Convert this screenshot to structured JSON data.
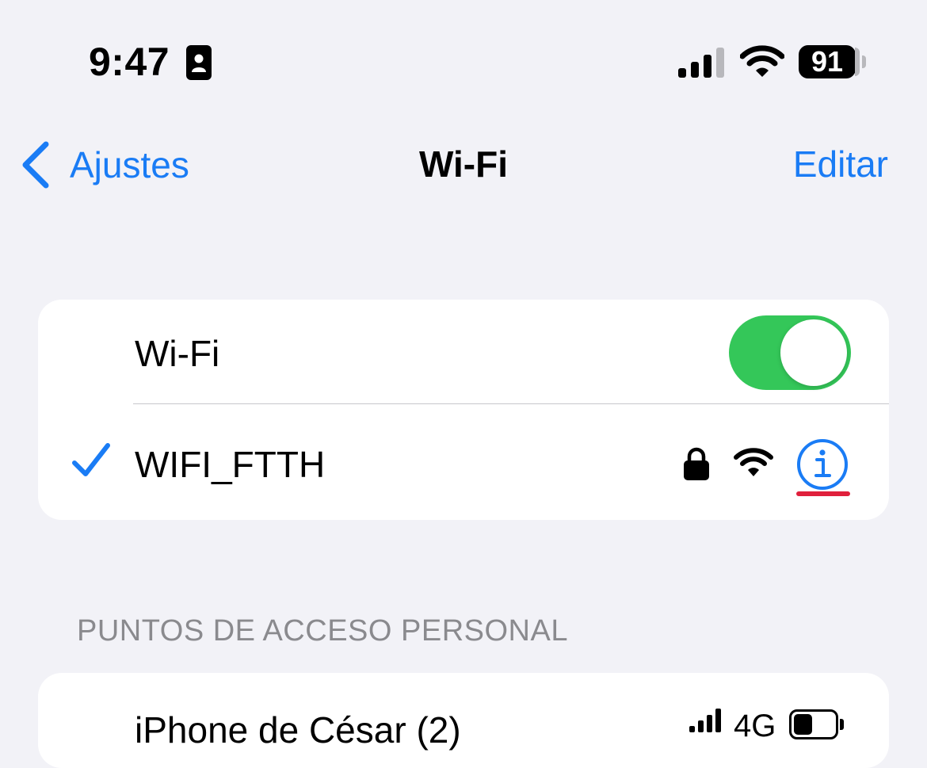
{
  "status_bar": {
    "time": "9:47",
    "battery_level": "91",
    "icons": [
      "contact-card-icon",
      "cellular-signal-icon",
      "wifi-icon",
      "battery-icon"
    ]
  },
  "nav": {
    "back_label": "Ajustes",
    "title": "Wi-Fi",
    "edit_label": "Editar"
  },
  "wifi_section": {
    "wifi_toggle_label": "Wi-Fi",
    "wifi_enabled": true,
    "connected_network": {
      "name": "WIFI_FTTH",
      "selected": true,
      "icons": [
        "checkmark-icon",
        "lock-icon",
        "wifi-signal-icon",
        "info-icon"
      ]
    }
  },
  "hotspots_section": {
    "header": "PUNTOS DE ACCESO PERSONAL",
    "items": [
      {
        "name": "iPhone de César (2)",
        "network_type": "4G",
        "battery_fraction": 0.45
      }
    ]
  },
  "colors": {
    "background": "#f2f2f7",
    "accent_blue": "#1a7cf5",
    "toggle_green": "#34c759",
    "highlight_red": "#e0203c",
    "secondary_text": "#8a8a8e"
  }
}
